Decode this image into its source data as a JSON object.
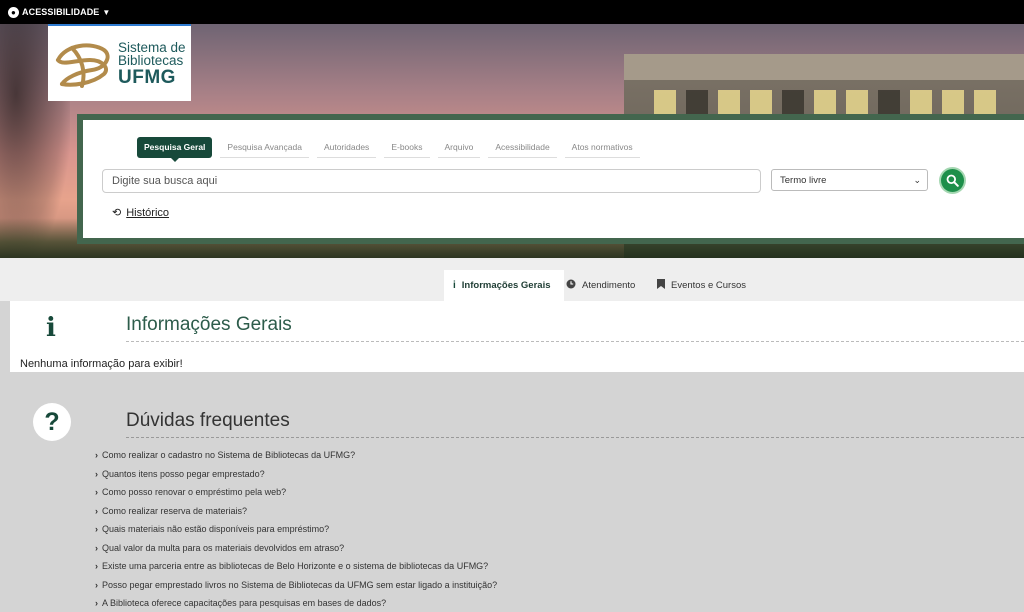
{
  "topbar": {
    "accessibility_label": "ACESSIBILIDADE"
  },
  "logo": {
    "line1": "Sistema de",
    "line2": "Bibliotecas",
    "line3": "UFMG"
  },
  "search": {
    "tabs": [
      {
        "label": "Pesquisa Geral",
        "active": true
      },
      {
        "label": "Pesquisa Avançada"
      },
      {
        "label": "Autoridades"
      },
      {
        "label": "E-books"
      },
      {
        "label": "Arquivo"
      },
      {
        "label": "Acessibilidade"
      },
      {
        "label": "Atos normativos"
      }
    ],
    "placeholder": "Digite sua busca aqui",
    "field_selected": "Termo livre",
    "history_label": "Histórico"
  },
  "info_tabs": [
    {
      "label": "Informações Gerais",
      "icon": "info-icon",
      "active": true
    },
    {
      "label": "Atendimento",
      "icon": "clock-icon"
    },
    {
      "label": "Eventos e Cursos",
      "icon": "bookmark-icon"
    }
  ],
  "info": {
    "title": "Informações Gerais",
    "empty_message": "Nenhuma informação para exibir!"
  },
  "faq": {
    "title": "Dúvidas frequentes",
    "items": [
      "Como realizar o cadastro no Sistema de Bibliotecas da UFMG?",
      "Quantos itens posso pegar emprestado?",
      "Como posso renovar o empréstimo pela web?",
      "Como realizar reserva de materiais?",
      "Quais materiais não estão disponíveis para empréstimo?",
      "Qual valor da multa para os materiais devolvidos em atraso?",
      "Existe uma parceria entre as bibliotecas de Belo Horizonte e o sistema de bibliotecas da UFMG?",
      "Posso pegar emprestado livros no Sistema de Bibliotecas da UFMG sem estar ligado a instituição?",
      "A Biblioteca oferece capacitações para pesquisas em bases de dados?"
    ]
  },
  "colors": {
    "primary": "#17493a",
    "accent": "#1d8f4a",
    "panel_border": "#43664e"
  }
}
